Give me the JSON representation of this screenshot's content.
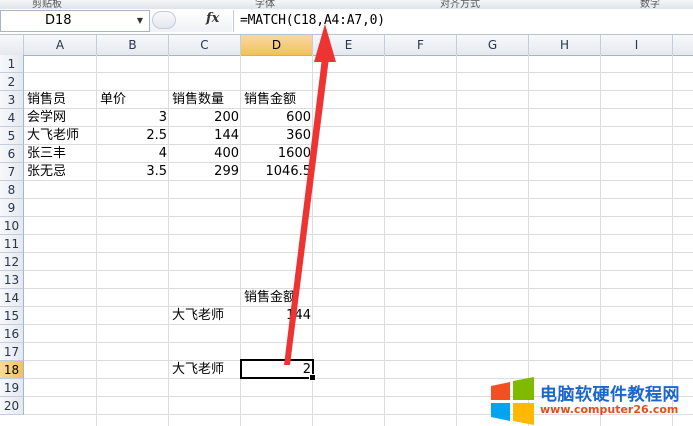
{
  "ribbon": {
    "groups": [
      "剪贴板",
      "字体",
      "对齐方式",
      "数字"
    ]
  },
  "formula_bar": {
    "name_box": "D18",
    "fx_label": "fx",
    "formula": "=MATCH(C18,A4:A7,0)"
  },
  "columns": [
    "A",
    "B",
    "C",
    "D",
    "E",
    "F",
    "G",
    "H",
    "I"
  ],
  "rows": [
    "1",
    "2",
    "3",
    "4",
    "5",
    "6",
    "7",
    "8",
    "9",
    "10",
    "11",
    "12",
    "13",
    "14",
    "15",
    "16",
    "17",
    "18",
    "19",
    "20"
  ],
  "selected": {
    "column": "D",
    "row": "18"
  },
  "table": {
    "headers": [
      "销售员",
      "单价",
      "销售数量",
      "销售金额"
    ],
    "rows": [
      [
        "会学网",
        "3",
        "200",
        "600"
      ],
      [
        "大飞老师",
        "2.5",
        "144",
        "360"
      ],
      [
        "张三丰",
        "4",
        "400",
        "1600"
      ],
      [
        "张无忌",
        "3.5",
        "299",
        "1046.5"
      ]
    ]
  },
  "lookup": {
    "d14_header": "销售金额",
    "c15_name": "大飞老师",
    "d15_value": "144",
    "c18_name": "大飞老师",
    "d18_result": "2"
  },
  "watermark": {
    "title": "电脑软硬件教程网",
    "url": "www.computer26.com",
    "colors": [
      "#f25022",
      "#7fba00",
      "#00a4ef",
      "#ffb900"
    ]
  },
  "annotation_color": "#ee3333"
}
